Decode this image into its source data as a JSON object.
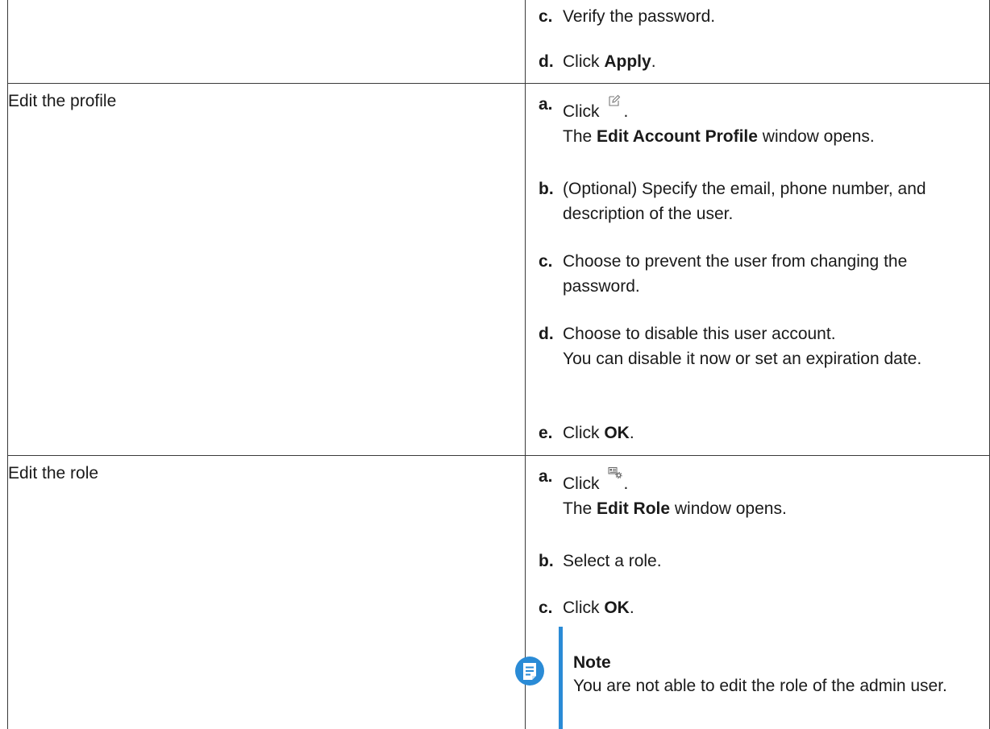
{
  "rows": [
    {
      "steps": [
        {
          "letter": "c.",
          "text": "Verify the password."
        },
        {
          "letter": "d.",
          "pre": "Click ",
          "bold": "Apply",
          "post": "."
        }
      ]
    },
    {
      "action": "Edit the profile",
      "steps": [
        {
          "letter": "a.",
          "pre": "Click",
          "post": ".",
          "icon": "edit-icon",
          "line2_pre": "The ",
          "line2_bold": "Edit Account Profile",
          "line2_post": " window opens."
        },
        {
          "letter": "b.",
          "text": "(Optional) Specify the email, phone number, and description of the user."
        },
        {
          "letter": "c.",
          "text": "Choose to prevent the user from changing the password."
        },
        {
          "letter": "d.",
          "text": "Choose to disable this user account.",
          "line2": "You can disable it now or set an expiration date."
        },
        {
          "letter": "e.",
          "pre": "Click ",
          "bold": "OK",
          "post": "."
        }
      ]
    },
    {
      "action": "Edit the role",
      "steps": [
        {
          "letter": "a.",
          "pre": "Click",
          "post": ".",
          "icon": "role-settings-icon",
          "line2_pre": "The ",
          "line2_bold": "Edit Role",
          "line2_post": " window opens."
        },
        {
          "letter": "b.",
          "text": "Select a role."
        },
        {
          "letter": "c.",
          "pre": "Click ",
          "bold": "OK",
          "post": "."
        }
      ]
    }
  ],
  "note": {
    "icon": "note-icon",
    "title": "Note",
    "text": "You are not able to edit the role of the admin user.",
    "accent_color": "#2a8bd6"
  }
}
